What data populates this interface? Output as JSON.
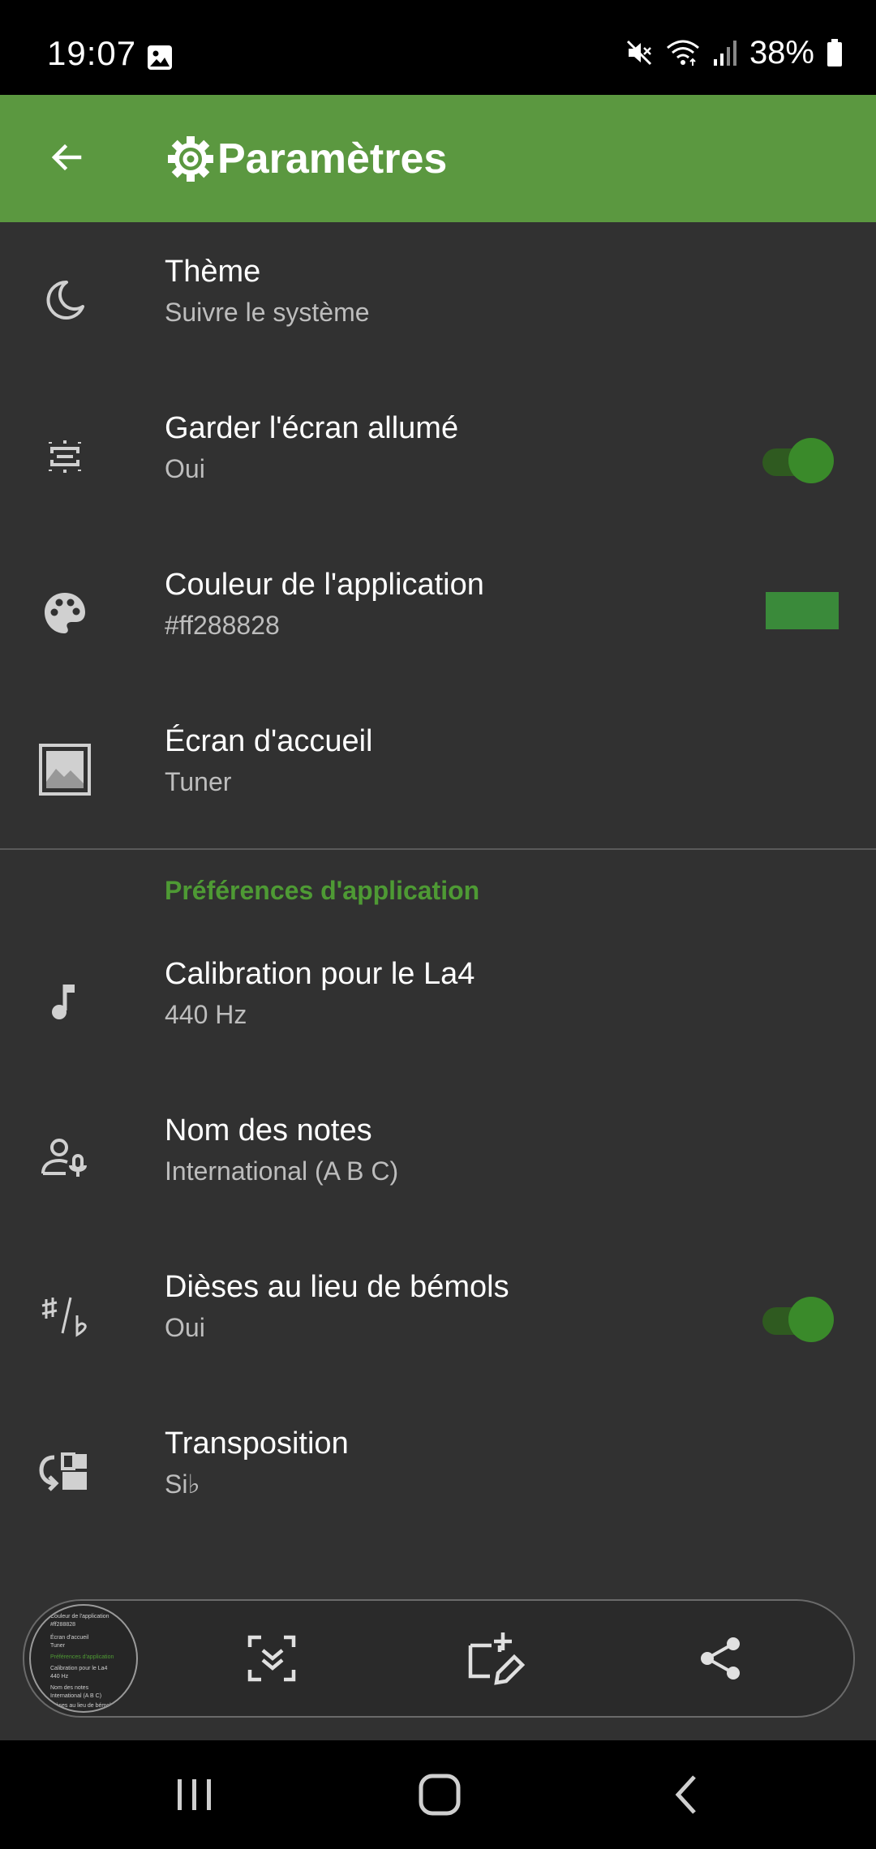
{
  "status_bar": {
    "time": "19:07",
    "battery_percent": "38%",
    "icons": [
      "gallery-icon",
      "mute-icon",
      "wifi-icon",
      "signal-icon",
      "battery-icon"
    ]
  },
  "app_bar": {
    "title": "Paramètres",
    "back_icon": "arrow-back-icon",
    "title_icon": "gear-icon"
  },
  "colors": {
    "app_bar": "#5b9840",
    "accent": "#4e9a34",
    "background": "#313131",
    "swatch": "#3a8a3a"
  },
  "settings": {
    "general": [
      {
        "title": "Thème",
        "subtitle": "Suivre le système",
        "icon": "moon-icon"
      },
      {
        "title": "Garder l'écran allumé",
        "subtitle": "Oui",
        "icon": "screen-on-icon",
        "toggle_on": true
      },
      {
        "title": "Couleur de l'application",
        "subtitle": "#ff288828",
        "icon": "palette-icon"
      },
      {
        "title": "Écran d'accueil",
        "subtitle": "Tuner",
        "icon": "image-icon"
      }
    ],
    "section_header": "Préférences d'application",
    "app_prefs": [
      {
        "title": "Calibration pour le La4",
        "subtitle": "440 Hz",
        "icon": "music-note-icon"
      },
      {
        "title": "Nom des notes",
        "subtitle": "International (A B C)",
        "icon": "voice-person-icon"
      },
      {
        "title": "Dièses au lieu de bémols",
        "subtitle": "Oui",
        "icon": "sharp-flat-icon",
        "toggle_on": true
      },
      {
        "title": "Transposition",
        "subtitle": "Si♭",
        "icon": "transpose-icon"
      }
    ]
  },
  "capture_toolbar": {
    "thumbnail_lines": [
      "Couleur de l'application",
      "#ff288828",
      "Écran d'accueil",
      "Tuner",
      "Préférences d'application",
      "Calibration pour le La4",
      "440 Hz",
      "Nom des notes",
      "International (A B C)",
      "Dièses au lieu de bémols"
    ],
    "buttons": [
      "scroll-capture-icon",
      "crop-edit-icon",
      "share-icon"
    ]
  },
  "nav_bar": {
    "buttons": [
      "recents-icon",
      "home-icon",
      "back-icon"
    ]
  }
}
